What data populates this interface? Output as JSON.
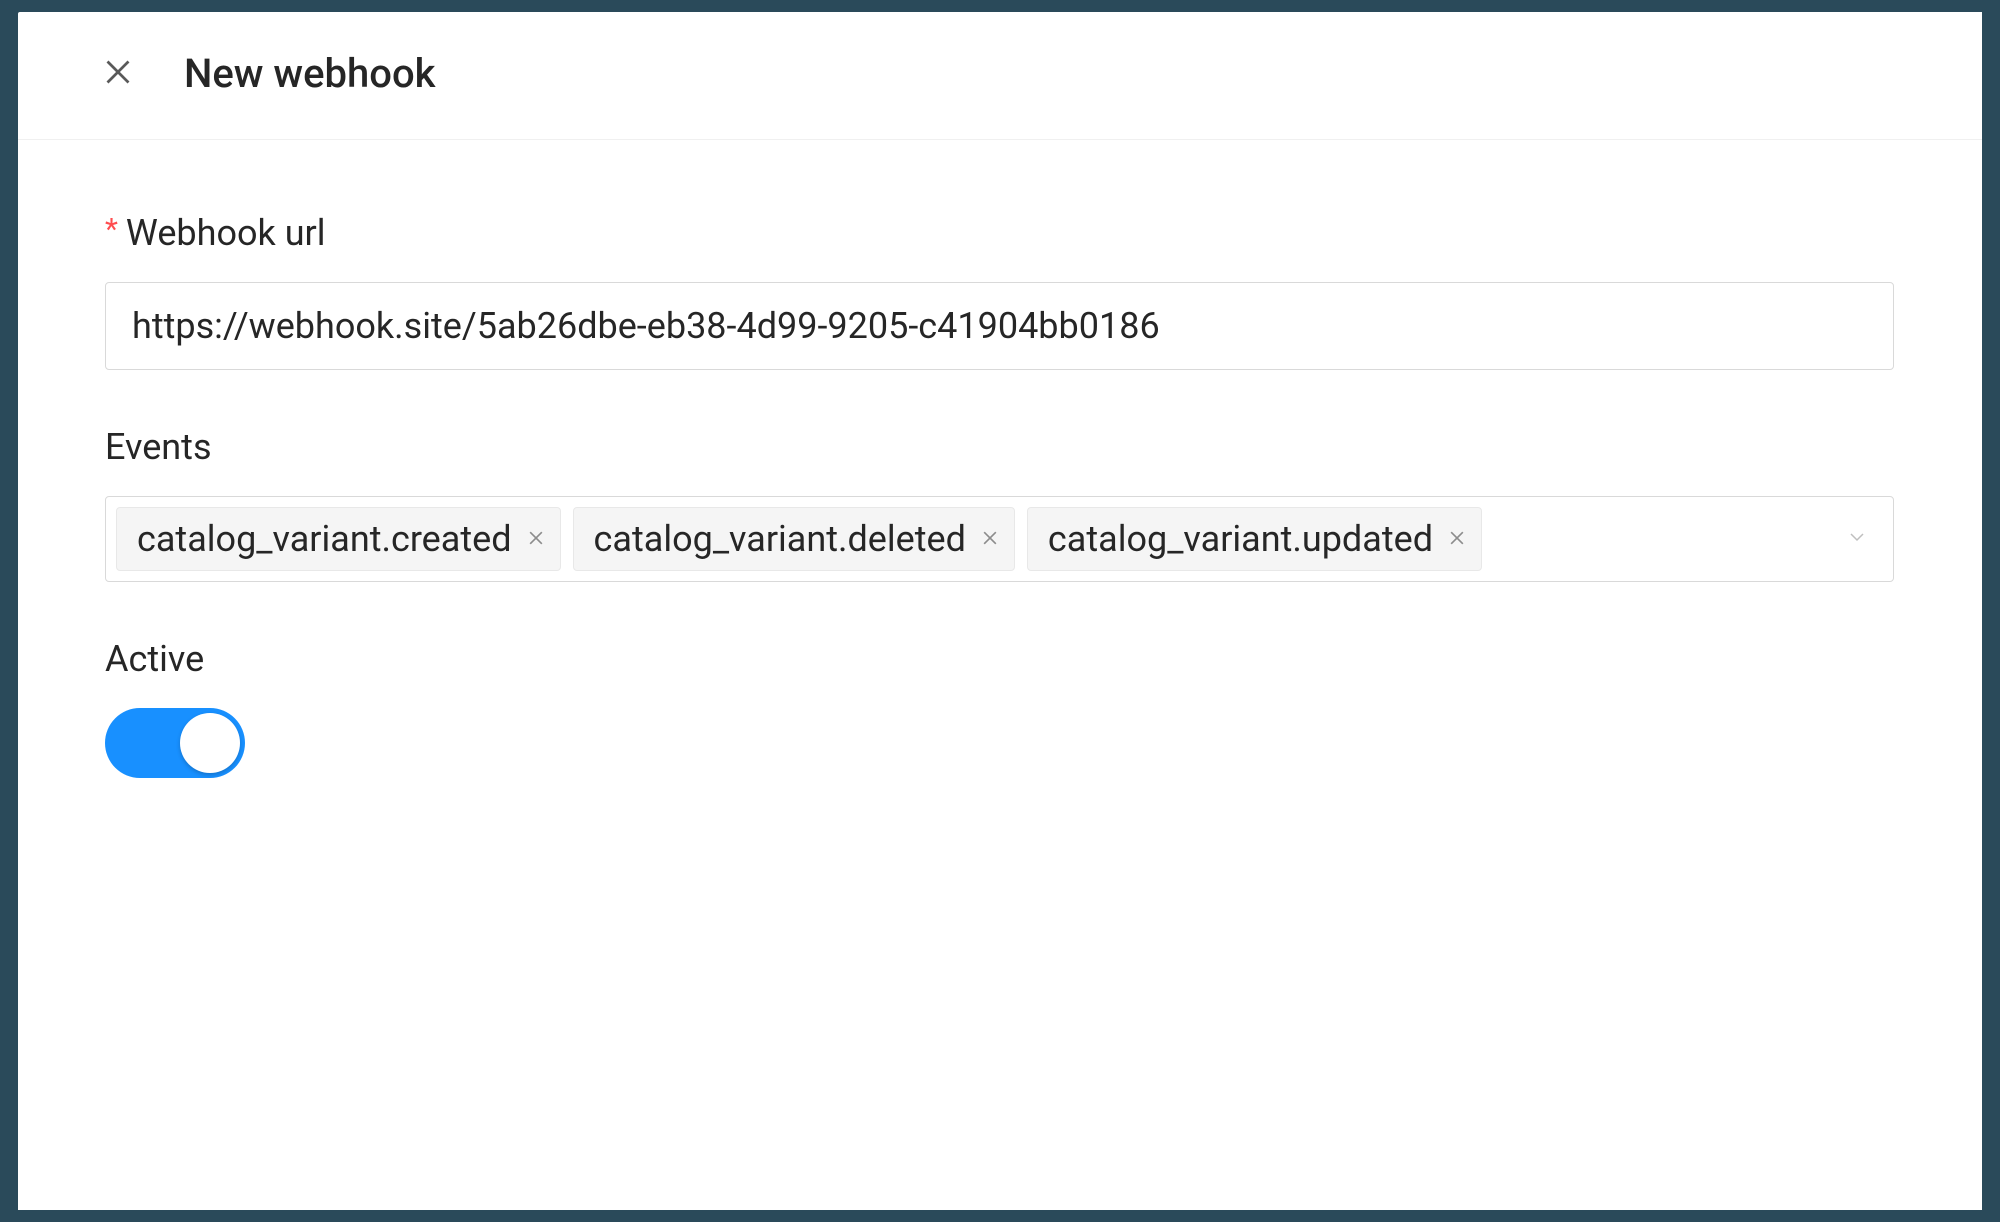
{
  "modal": {
    "title": "New webhook",
    "fields": {
      "url": {
        "label": "Webhook url",
        "required": true,
        "value": "https://webhook.site/5ab26dbe-eb38-4d99-9205-c41904bb0186"
      },
      "events": {
        "label": "Events",
        "selected": [
          "catalog_variant.created",
          "catalog_variant.deleted",
          "catalog_variant.updated"
        ]
      },
      "active": {
        "label": "Active",
        "value": true
      }
    }
  }
}
